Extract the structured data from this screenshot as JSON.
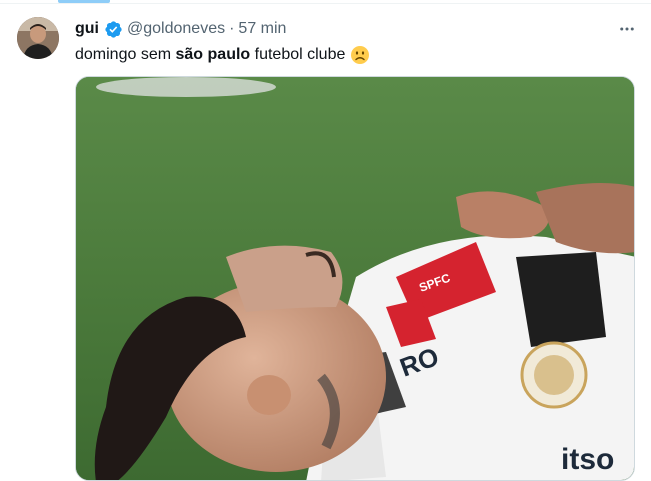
{
  "tweet": {
    "display_name": "gui",
    "handle": "@goldoneves",
    "separator": "·",
    "time": "57 min",
    "text_before": "domingo sem ",
    "text_bold": "são paulo",
    "text_after": " futebol clube",
    "emoji_icon": "frowning-face-icon",
    "verified_icon": "verified-badge-icon",
    "more_icon": "more-horizontal-icon"
  },
  "media": {
    "kit_text_1": "RO",
    "kit_text_2": "itso",
    "kit_text_3": "SPFC"
  },
  "colors": {
    "accent": "#1d9bf0",
    "text_primary": "#0f1419",
    "text_secondary": "#536471",
    "pitch": "#4f7d3f"
  }
}
